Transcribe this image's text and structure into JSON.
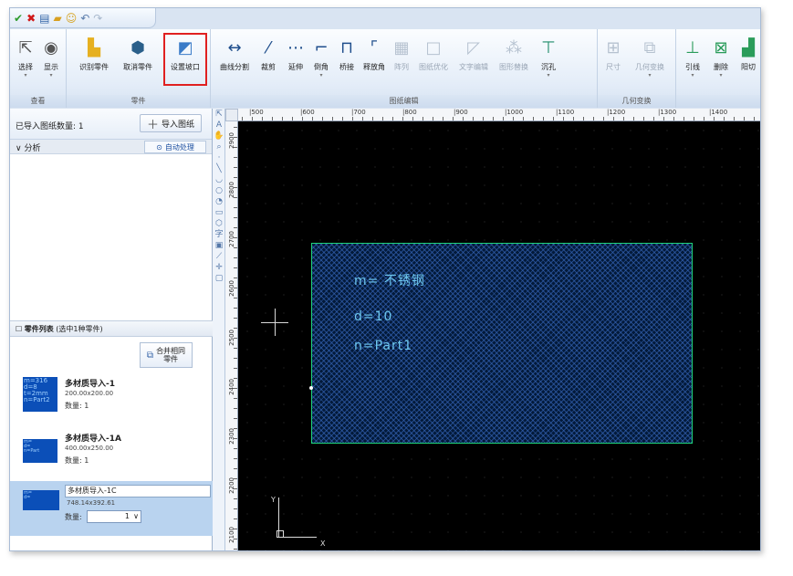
{
  "quick_access": {
    "confirm_icon": "checkmark-icon",
    "cancel_icon": "x-icon",
    "save_icon": "save-icon",
    "open_icon": "folder-open-icon",
    "undo_icon": "undo-icon",
    "redo_icon": "redo-icon"
  },
  "ribbon": {
    "groups": {
      "view": "查看",
      "part": "零件",
      "drawing_edit": "图纸编辑",
      "geometry": "几何变换"
    },
    "view": {
      "select": "选择",
      "display": "显示"
    },
    "part": {
      "identify": "识别零件",
      "cancel": "取消零件",
      "set_bevel": "设置坡口"
    },
    "edit": {
      "curve_split": "曲线分割",
      "trim": "裁剪",
      "extend": "延伸",
      "chamfer": "倒角",
      "bridge": "桥接",
      "release_corner": "释放角",
      "array": "阵列",
      "optimize": "图纸优化",
      "text_edit": "文字编辑",
      "replace": "图形替换",
      "countersink": "沉孔"
    },
    "geom": {
      "size": "尺寸",
      "transform": "几何变换"
    },
    "extra": {
      "lead": "引线",
      "delete": "删除",
      "cut": "阳切"
    }
  },
  "left_panel": {
    "imported_count_label": "已导入图纸数量: 1",
    "import_button": "导入图纸",
    "analysis_label": "分析",
    "auto_process": "自动处理",
    "parts_header_title": "零件列表",
    "parts_header_sub": "(选中1种零件)",
    "merge_button_line1": "合并相同",
    "merge_button_line2": "零件",
    "parts": [
      {
        "name": "多材质导入-1",
        "dims": "200.00x200.00",
        "qty": "数量: 1",
        "thumb": "m=316\nd=8\nt=2mm\nn=Part2"
      },
      {
        "name": "多材质导入-1A",
        "dims": "400.00x250.00",
        "qty": "数量: 1",
        "thumb": "m=\nd=\nn=Part"
      },
      {
        "name": "多材质导入-1C",
        "dims": "748.14x392.61",
        "qty_label": "数量:",
        "qty_value": "1",
        "thumb": "m=\nd="
      }
    ]
  },
  "ruler": {
    "h_ticks": [
      "500",
      "600",
      "700",
      "800",
      "900",
      "1000",
      "1100",
      "1200",
      "1300",
      "1400"
    ],
    "v_ticks": [
      "2900",
      "2800",
      "2700",
      "2600",
      "2500",
      "2400",
      "2300",
      "2200",
      "2100"
    ]
  },
  "canvas": {
    "text_material": "m= 不锈钢",
    "text_thickness": "d=10",
    "text_name": "n=Part1",
    "axis_y": "Y",
    "axis_x": "X"
  },
  "colors": {
    "part_outline": "#1fd27a",
    "part_text": "#6ec8f0",
    "highlight": "#e02020",
    "thumb_bg": "#0b4fb8"
  }
}
